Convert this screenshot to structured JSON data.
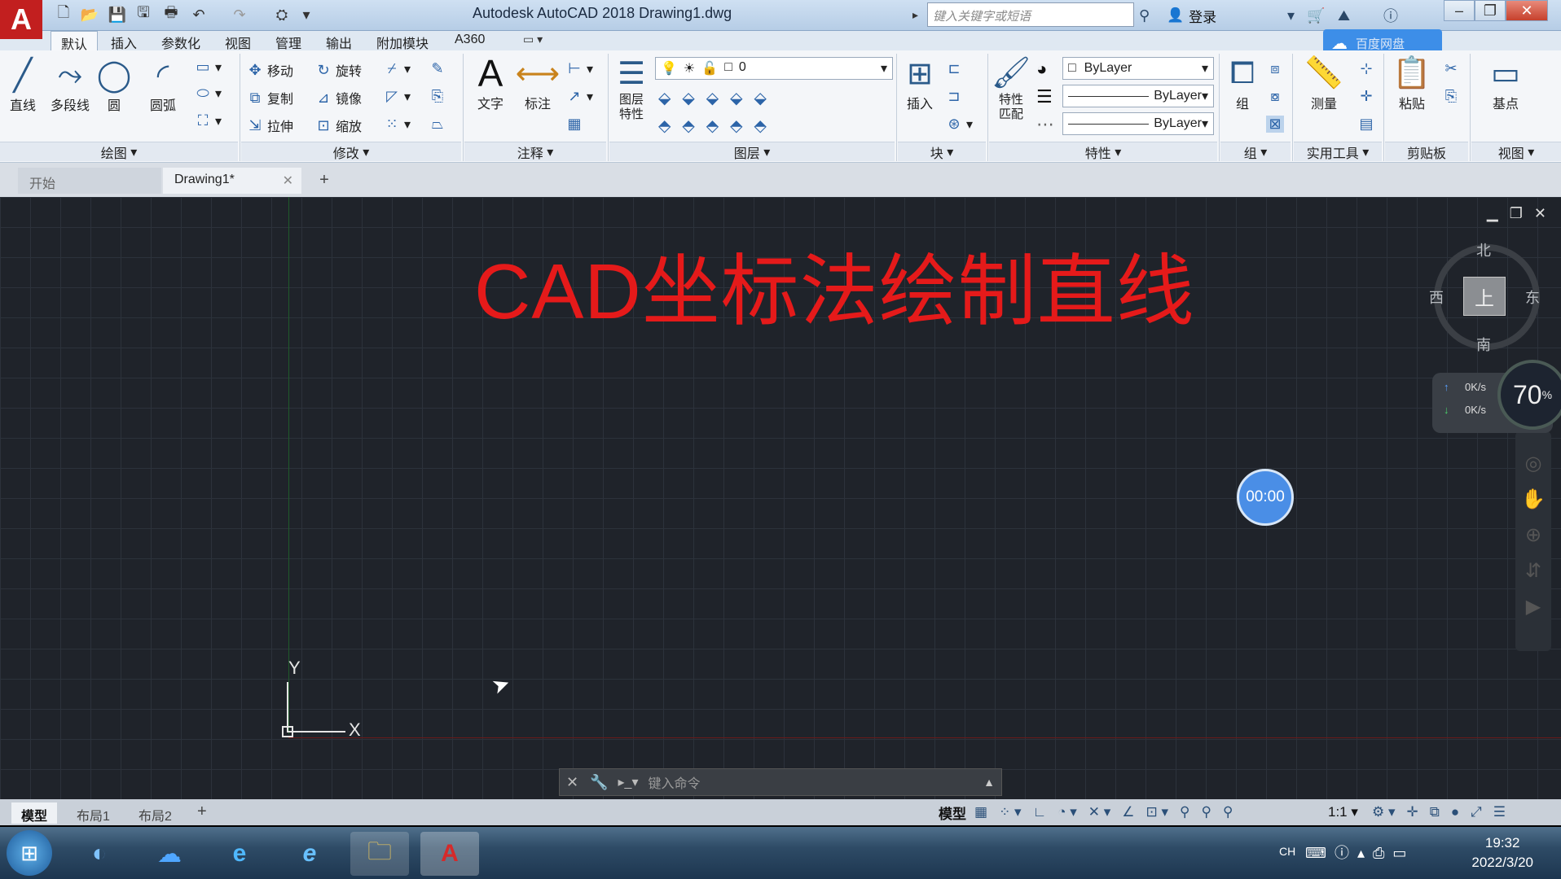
{
  "window": {
    "title": "Autodesk AutoCAD 2018    Drawing1.dwg",
    "logo": "A",
    "search_placeholder": "键入关键字或短语",
    "login": "登录"
  },
  "ribbon_tabs": [
    "默认",
    "插入",
    "参数化",
    "视图",
    "管理",
    "输出",
    "附加模块",
    "A360"
  ],
  "draw_panel": {
    "label": "绘图",
    "line": "直线",
    "polyline": "多段线",
    "circle": "圆",
    "arc": "圆弧"
  },
  "modify_panel": {
    "label": "修改",
    "move": "移动",
    "rotate": "旋转",
    "copy": "复制",
    "mirror": "镜像",
    "stretch": "拉伸",
    "scale": "缩放"
  },
  "annotation_panel": {
    "label": "注释",
    "text": "文字",
    "dimension": "标注"
  },
  "layers_panel": {
    "label": "图层",
    "layer_props": "图层特性",
    "current_layer": "0"
  },
  "block_panel": {
    "label": "块",
    "insert": "插入"
  },
  "properties_panel": {
    "label": "特性",
    "match": "特性匹配",
    "color": "ByLayer",
    "linetype": "ByLayer",
    "lineweight": "ByLayer"
  },
  "groups_panel": {
    "label": "组",
    "group": "组"
  },
  "utilities_panel": {
    "label": "实用工具",
    "measure": "测量"
  },
  "clipboard_panel": {
    "label": "剪贴板",
    "paste": "粘贴"
  },
  "view_panel": {
    "label": "视图",
    "base": "基点"
  },
  "doc_tabs": {
    "start": "开始",
    "drawing": "Drawing1*"
  },
  "canvas": {
    "title": "CAD坐标法绘制直线",
    "viewcube": {
      "north": "北",
      "south": "南",
      "east": "东",
      "west": "西",
      "top": "上"
    },
    "net": {
      "up": "0K/s",
      "down": "0K/s",
      "percent": "70",
      "unit": "%"
    },
    "timer": "00:00",
    "ucs_y": "Y",
    "ucs_x": "X",
    "command_placeholder": "键入命令",
    "baidu_label": "百度网盘"
  },
  "layout_tabs": [
    "模型",
    "布局1",
    "布局2"
  ],
  "status": {
    "model": "模型",
    "scale": "1:1"
  },
  "taskbar": {
    "ime": "CH",
    "time": "19:32",
    "date": "2022/3/20"
  }
}
